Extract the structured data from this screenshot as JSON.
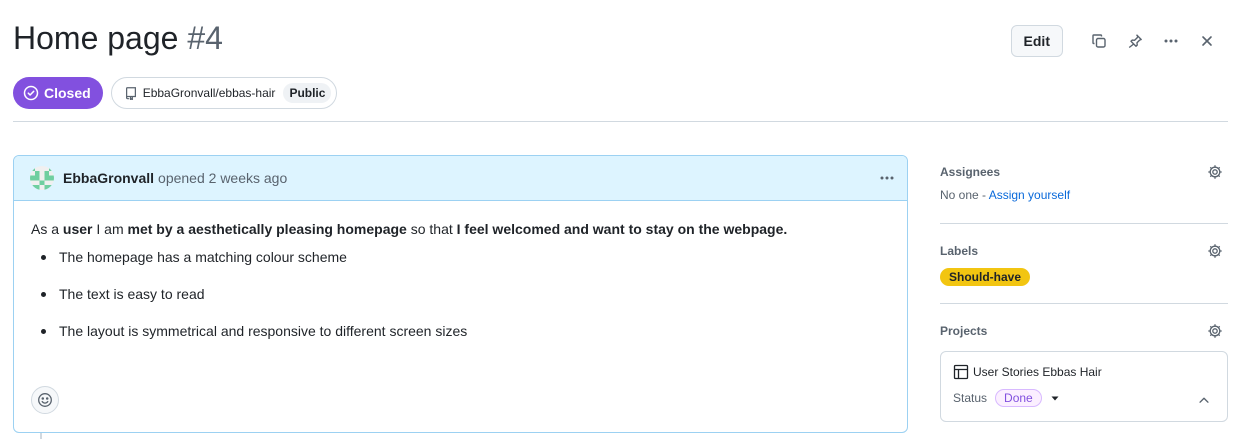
{
  "issue": {
    "title": "Home page",
    "number": "#4",
    "state": "Closed",
    "repo": "EbbaGronvall/ebbas-hair",
    "visibility": "Public"
  },
  "toolbar": {
    "edit_label": "Edit",
    "icons": [
      "copy-icon",
      "pin-icon",
      "kebab-horizontal-icon",
      "close-icon"
    ]
  },
  "comment": {
    "author": "EbbaGronvall",
    "opened_text": "opened 2 weeks ago",
    "body": {
      "p1": "As a ",
      "b1": "user",
      "p2": " I am ",
      "b2": "met by a aesthetically pleasing homepage",
      "p3": " so that ",
      "b3": "I feel welcomed and want to stay on the webpage."
    },
    "bullets": [
      "The homepage has a matching colour scheme",
      "The text is easy to read",
      "The layout is symmetrical and responsive to different screen sizes"
    ]
  },
  "sidebar": {
    "assignees": {
      "title": "Assignees",
      "none_text": "No one - ",
      "assign_link": "Assign yourself"
    },
    "labels": {
      "title": "Labels",
      "items": [
        "Should-have"
      ]
    },
    "projects": {
      "title": "Projects",
      "project_name": "User Stories Ebbas Hair",
      "status_label": "Status",
      "status_value": "Done"
    }
  },
  "colors": {
    "closed_badge": "#8250df",
    "comment_header": "#ddf4ff",
    "label_should_have": "#f2c511",
    "link": "#0969da"
  }
}
